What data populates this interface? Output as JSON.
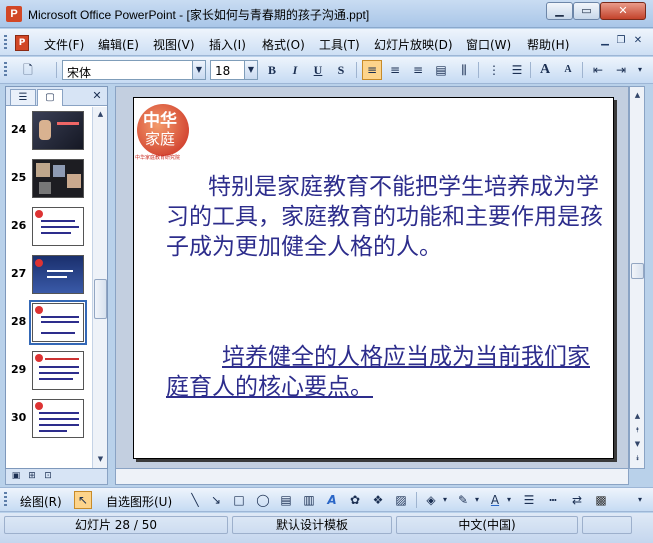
{
  "window": {
    "title": "Microsoft Office PowerPoint - [家长如何与青春期的孩子沟通.ppt]",
    "app_icon_letter": "P",
    "min_glyph": "▁",
    "max_glyph": "▭",
    "close_glyph": "✕"
  },
  "menu": {
    "doc_icon_letter": "P",
    "items": [
      "文件(F)",
      "编辑(E)",
      "视图(V)",
      "插入(I)",
      "格式(O)",
      "工具(T)",
      "幻灯片放映(D)",
      "窗口(W)",
      "帮助(H)"
    ]
  },
  "format_toolbar": {
    "font_name": "宋体",
    "font_size": "18",
    "bold": "B",
    "italic": "I",
    "underline": "U",
    "shadow": "S",
    "increase_font": "A",
    "decrease_font": "A"
  },
  "outline_panel": {
    "slides": [
      {
        "number": "24"
      },
      {
        "number": "25"
      },
      {
        "number": "26"
      },
      {
        "number": "27"
      },
      {
        "number": "28",
        "selected": true
      },
      {
        "number": "29"
      },
      {
        "number": "30"
      }
    ]
  },
  "slide": {
    "logo_line1": "中华",
    "logo_line2": "家庭",
    "logo_subtitle": "中华家庭教育研究院",
    "paragraph1": "特别是家庭教育不能把学生培养成为学习的工具，家庭教育的功能和主要作用是孩子成为更加健全人格的人。",
    "paragraph2": "培养健全的人格应当成为当前我们家庭育人的核心要点。"
  },
  "draw_toolbar": {
    "draw_label": "绘图(R)",
    "autoshapes_label": "自选图形(U)"
  },
  "status": {
    "slide_info": "幻灯片 28 / 50",
    "design": "默认设计模板",
    "language": "中文(中国)"
  },
  "colors": {
    "slide_text": "#2d2d8c",
    "accent_selected": "#fdd48b"
  }
}
